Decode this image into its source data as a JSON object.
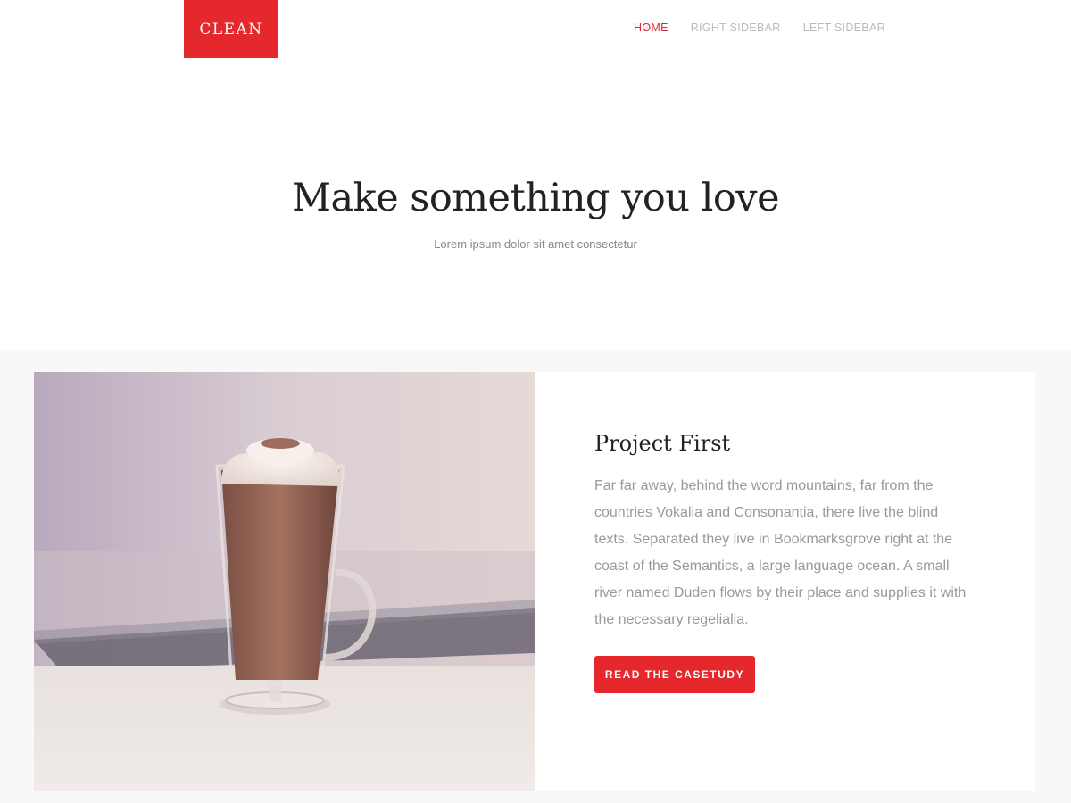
{
  "header": {
    "logo": "CLEAN",
    "nav": [
      {
        "label": "HOME",
        "active": true
      },
      {
        "label": "RIGHT SIDEBAR",
        "active": false
      },
      {
        "label": "LEFT SIDEBAR",
        "active": false
      }
    ]
  },
  "hero": {
    "title": "Make something you love",
    "subtitle": "Lorem ipsum dolor sit amet consectetur"
  },
  "project": {
    "image_icon": "hot-chocolate-photo",
    "title": "Project First",
    "description": "Far far away, behind the word mountains, far from the countries Vokalia and Consonantia, there live the blind texts. Separated they live in Bookmarksgrove right at the coast of the Semantics, a large language ocean. A small river named Duden flows by their place and supplies it with the necessary regelialia.",
    "button_label": "READ THE CASETUDY"
  },
  "colors": {
    "accent": "#e5282b",
    "nav_inactive": "#bbbbbb",
    "text_muted": "#999999",
    "section_bg": "#f8f8f8"
  }
}
